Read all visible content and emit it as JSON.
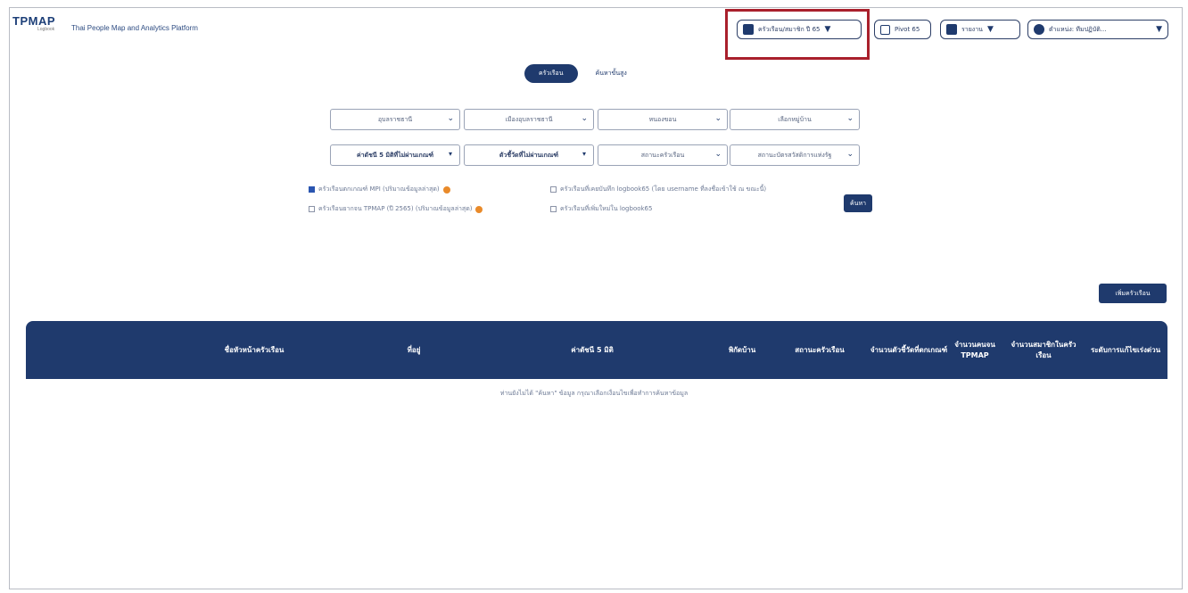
{
  "header": {
    "logo": "TPMAP",
    "logo_sub": "Logbook",
    "subtitle": "Thai People Map and Analytics Platform",
    "household_dropdown": "ครัวเรือน/สมาชิก ปี 65",
    "pivot_button": "Pivot 65",
    "report_dropdown": "รายงาน",
    "user_dropdown": "ตำแหน่ง: ทีมปฏิบัติ..."
  },
  "tabs": [
    {
      "label": "ครัวเรือน",
      "active": true
    },
    {
      "label": "ค้นหาขั้นสูง",
      "active": false
    }
  ],
  "filters": {
    "province": "อุบลราชธานี",
    "district": "เมืองอุบลราชธานี",
    "subdistrict": "หนองขอน",
    "village": "เลือกหมู่บ้าน",
    "mpi_dim": "ค่าดัชนี 5 มิติที่ไม่ผ่านเกณฑ์",
    "indicator": "ตัวชี้วัดที่ไม่ผ่านเกณฑ์",
    "household_status": "สถานะครัวเรือน",
    "welfare_status": "สถานะบัตรสวัสดิการแห่งรัฐ"
  },
  "checkboxes": [
    {
      "label": "ครัวเรือนตกเกณฑ์ MPI (ปริมาณข้อมูลล่าสุด)",
      "checked": true,
      "warn": true
    },
    {
      "label": "ครัวเรือนยากจน TPMAP (ปี 2565) (ปริมาณข้อมูลล่าสุด)",
      "checked": false,
      "warn": true
    },
    {
      "label": "ครัวเรือนที่เคยบันทึก logbook65 (โดย username ที่ลงชื่อเข้าใช้ ณ ขณะนี้)",
      "checked": false,
      "warn": false
    },
    {
      "label": "ครัวเรือนที่เพิ่มใหม่ใน logbook65",
      "checked": false,
      "warn": false
    }
  ],
  "search_button": "ค้นหา",
  "add_household_button": "เพิ่มครัวเรือน",
  "table": {
    "columns": [
      "ชื่อหัวหน้าครัวเรือน",
      "ที่อยู่",
      "ค่าดัชนี 5 มิติ",
      "พิกัดบ้าน",
      "สถานะครัวเรือน",
      "จำนวนตัวชี้วัดที่ตกเกณฑ์",
      "จำนวนคนจน TPMAP",
      "จำนวนสมาชิกในครัวเรือน",
      "ระดับการแก้ไขเร่งด่วน"
    ],
    "empty_message": "ท่านยังไม่ได้ \"ค้นหา\" ข้อมูล กรุณาเลือกเงื่อนไขเพื่อทำการค้นหาข้อมูล"
  }
}
